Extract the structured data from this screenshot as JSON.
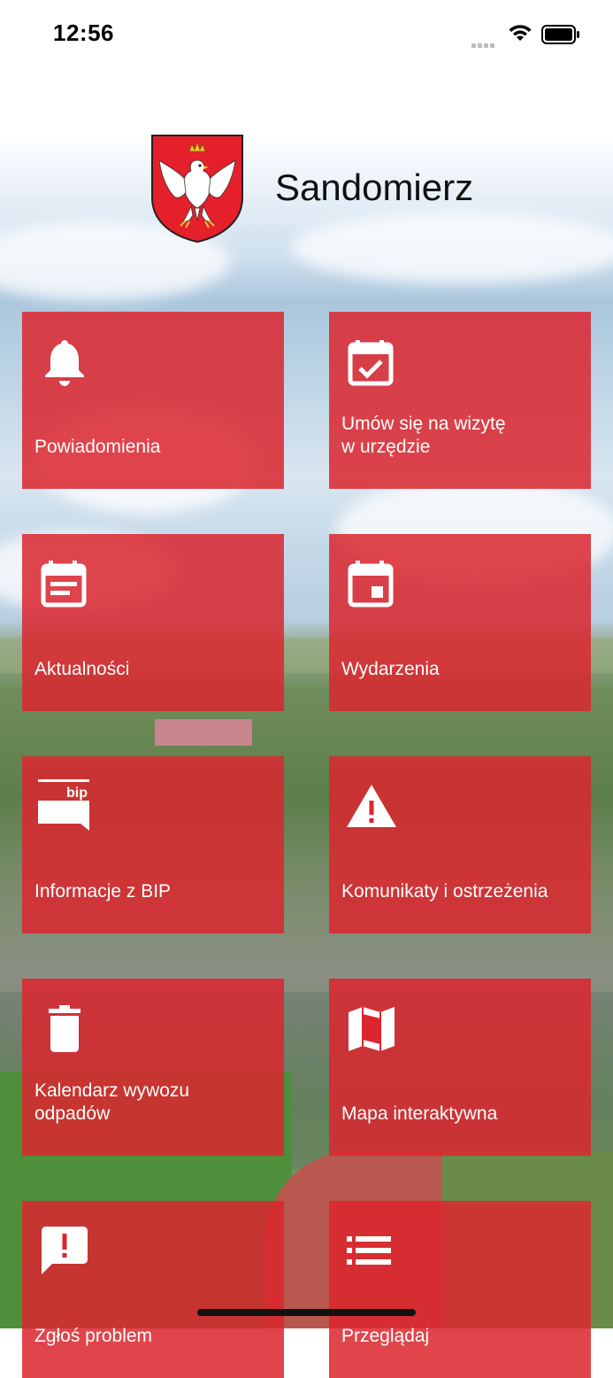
{
  "status_bar": {
    "time": "12:56",
    "wifi_icon": "wifi-icon",
    "battery_icon": "battery-icon"
  },
  "header": {
    "title": "Sandomierz",
    "crest_icon": "coat-of-arms-eagle"
  },
  "colors": {
    "tile_red": "#db262e",
    "title_text": "#111111",
    "tile_text": "#ffffff"
  },
  "tiles": [
    {
      "label": "Powiadomienia",
      "icon": "bell-icon"
    },
    {
      "label": "Umów się na wizytę\nw urzędzie",
      "icon": "calendar-check-icon"
    },
    {
      "label": "Aktualności",
      "icon": "calendar-news-icon"
    },
    {
      "label": "Wydarzenia",
      "icon": "calendar-event-icon"
    },
    {
      "label": "Informacje z BIP",
      "icon": "bip-icon",
      "icon_text": "bip"
    },
    {
      "label": "Komunikaty i ostrzeżenia",
      "icon": "warning-icon"
    },
    {
      "label": "Kalendarz wywozu\nodpadów",
      "icon": "trash-icon"
    },
    {
      "label": "Mapa interaktywna",
      "icon": "map-icon"
    },
    {
      "label": "Zgłoś problem",
      "icon": "report-problem-icon"
    },
    {
      "label": "Przeglądaj",
      "icon": "list-icon"
    }
  ]
}
